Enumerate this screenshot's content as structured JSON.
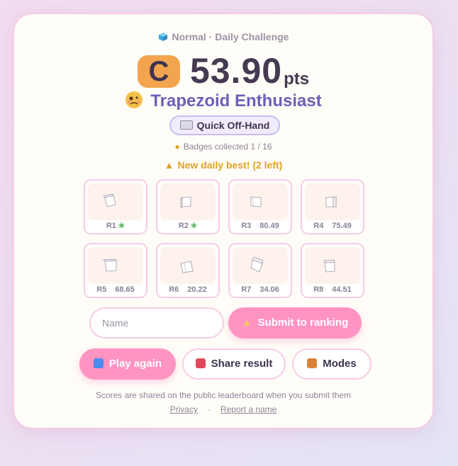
{
  "header": {
    "mode_label": "Normal · Daily Challenge",
    "grade": "C",
    "score": "53.90",
    "score_unit": "pts",
    "title": "Trapezoid Enthusiast",
    "badge": "Quick Off-Hand",
    "badges_collected": "Badges collected 1 / 16",
    "new_best": "New daily best! (2 left)"
  },
  "rounds": [
    {
      "label": "R1",
      "value": "",
      "sprout": true
    },
    {
      "label": "R2",
      "value": "",
      "sprout": true
    },
    {
      "label": "R3",
      "value": "80.49",
      "sprout": false
    },
    {
      "label": "R4",
      "value": "75.49",
      "sprout": false
    },
    {
      "label": "R5",
      "value": "68.65",
      "sprout": false
    },
    {
      "label": "R6",
      "value": "20.22",
      "sprout": false
    },
    {
      "label": "R7",
      "value": "34.06",
      "sprout": false
    },
    {
      "label": "R8",
      "value": "44.51",
      "sprout": false
    }
  ],
  "submit": {
    "name_placeholder": "Name",
    "submit_label": "Submit to ranking"
  },
  "actions": {
    "play_again": "Play again",
    "share": "Share result",
    "modes": "Modes"
  },
  "footer": {
    "note": "Scores are shared on the public leaderboard when you submit them",
    "privacy": "Privacy",
    "report": "Report a name"
  },
  "icons": {
    "mode": "cube-icon",
    "title": "woozy-face-icon",
    "badge": "keyboard-icon",
    "badges_collected": "masks-icon",
    "new_best": "trophy-icon",
    "sprout": "seedling-icon",
    "submit": "trophy-icon",
    "play_again": "repeat-icon",
    "share": "postbox-icon",
    "modes": "house-icon"
  },
  "colors": {
    "grade_bg": "#f2a54e",
    "title": "#6f5fb8",
    "new_best": "#e0a128",
    "pink_button": "#ff94c3",
    "card_border": "#f6cde3"
  }
}
